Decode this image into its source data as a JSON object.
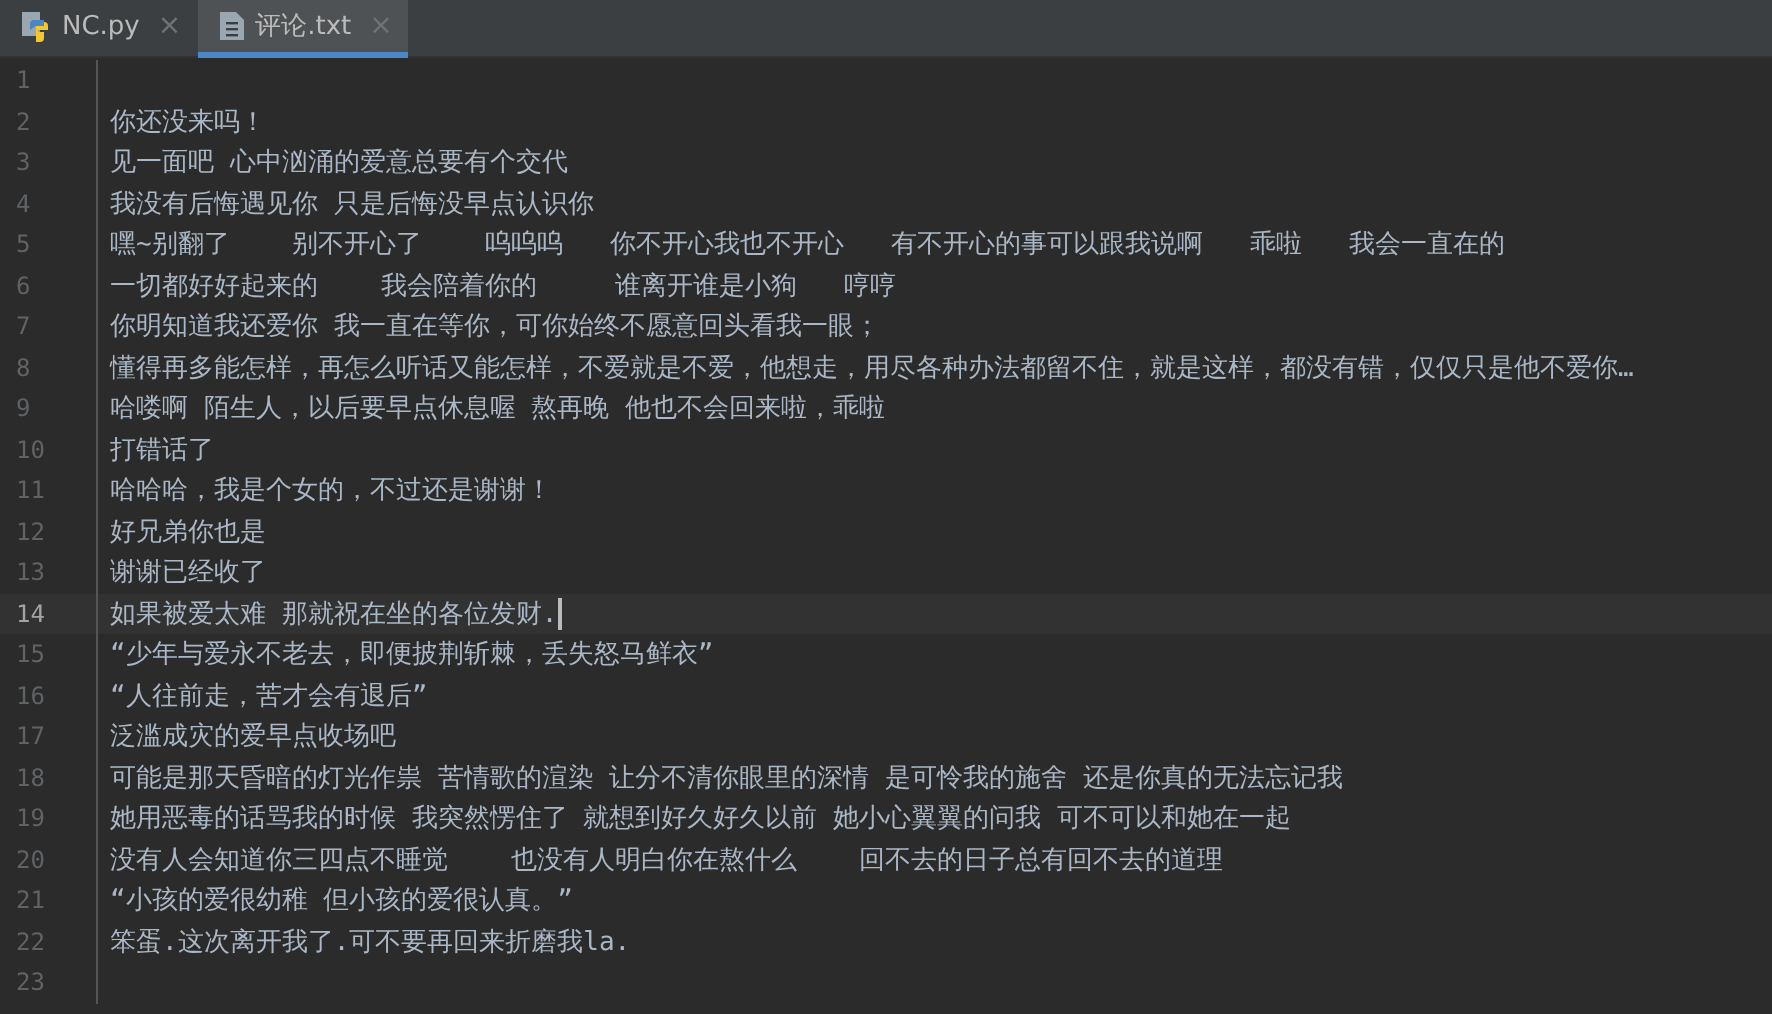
{
  "tabs": [
    {
      "label": "NC.py",
      "kind": "python",
      "close": "×",
      "selected": false
    },
    {
      "label": "评论.txt",
      "kind": "text",
      "close": "×",
      "selected": true
    }
  ],
  "lines": [
    {
      "number": "1",
      "current": false
    },
    {
      "number": "2",
      "text": "你还没来吗！",
      "current": false
    },
    {
      "number": "3",
      "text": "见一面吧 心中汹涌的爱意总要有个交代",
      "current": false
    },
    {
      "number": "4",
      "text": "我没有后悔遇见你 只是后悔没早点认识你",
      "current": false
    },
    {
      "number": "5",
      "text": "嘿~别翻了    别不开心了    呜呜呜   你不开心我也不开心   有不开心的事可以跟我说啊   乖啦   我会一直在的",
      "current": false
    },
    {
      "number": "6",
      "text": "一切都好好起来的    我会陪着你的     谁离开谁是小狗   哼哼",
      "current": false
    },
    {
      "number": "7",
      "text": "你明知道我还爱你 我一直在等你，可你始终不愿意回头看我一眼；",
      "current": false
    },
    {
      "number": "8",
      "text": "懂得再多能怎样，再怎么听话又能怎样，不爱就是不爱，他想走，用尽各种办法都留不住，就是这样，都没有错，仅仅只是他不爱你…",
      "current": false
    },
    {
      "number": "9",
      "text": "哈喽啊 陌生人，以后要早点休息喔 熬再晚 他也不会回来啦，乖啦",
      "current": false
    },
    {
      "number": "10",
      "text": "打错话了",
      "current": false
    },
    {
      "number": "11",
      "text": "哈哈哈，我是个女的，不过还是谢谢！",
      "current": false
    },
    {
      "number": "12",
      "text": "好兄弟你也是",
      "current": false
    },
    {
      "number": "13",
      "text": "谢谢已经收了",
      "current": false
    },
    {
      "number": "14",
      "text": "如果被爱太难 那就祝在坐的各位发财.",
      "current": true
    },
    {
      "number": "15",
      "text": "“少年与爱永不老去，即便披荆斩棘，丢失怒马鲜衣”",
      "current": false
    },
    {
      "number": "16",
      "text": "“人往前走，苦才会有退后”",
      "current": false
    },
    {
      "number": "17",
      "text": "泛滥成灾的爱早点收场吧",
      "current": false
    },
    {
      "number": "18",
      "text": "可能是那天昏暗的灯光作祟 苦情歌的渲染 让分不清你眼里的深情 是可怜我的施舍 还是你真的无法忘记我",
      "current": false
    },
    {
      "number": "19",
      "text": "她用恶毒的话骂我的时候 我突然愣住了 就想到好久好久以前 她小心翼翼的问我 可不可以和她在一起",
      "current": false
    },
    {
      "number": "20",
      "text": "没有人会知道你三四点不睡觉    也没有人明白你在熬什么    回不去的日子总有回不去的道理",
      "current": false
    },
    {
      "number": "21",
      "text": "“小孩的爱很幼稚 但小孩的爱很认真。”",
      "current": false
    },
    {
      "number": "22",
      "text": "笨蛋.这次离开我了.可不要再回来折磨我la.",
      "current": false
    },
    {
      "number": "23",
      "current": false
    }
  ]
}
